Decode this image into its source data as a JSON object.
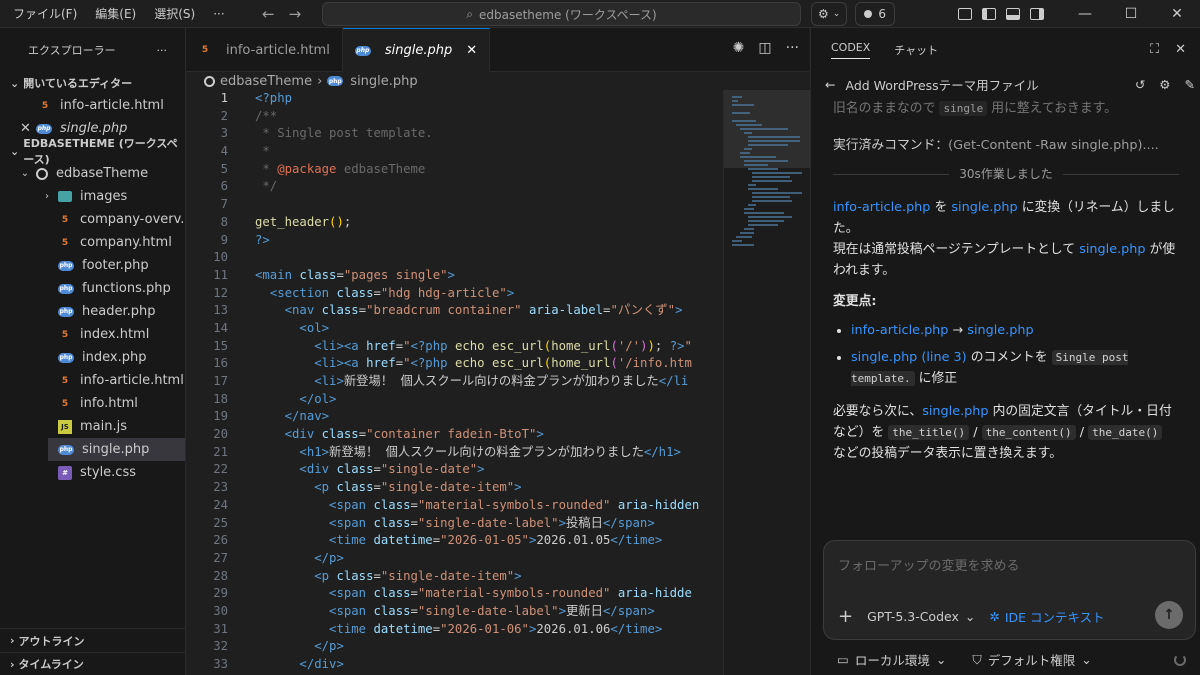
{
  "titlebar": {
    "menu": [
      "ファイル(F)",
      "編集(E)",
      "選択(S)",
      "···"
    ],
    "search": "edbasetheme (ワークスペース)",
    "badge_count": "6"
  },
  "sidebar": {
    "title": "エクスプローラー",
    "more": "···",
    "open_editors_label": "開いているエディター",
    "open_editors": [
      {
        "name": "info-article.html",
        "type": "html"
      },
      {
        "name": "single.php",
        "type": "php"
      }
    ],
    "workspace_label": "EDBASETHEME (ワークスペース)",
    "root_folder": "edbaseTheme",
    "files": [
      {
        "name": "images",
        "type": "folder"
      },
      {
        "name": "company-overv...",
        "type": "html"
      },
      {
        "name": "company.html",
        "type": "html"
      },
      {
        "name": "footer.php",
        "type": "php"
      },
      {
        "name": "functions.php",
        "type": "php"
      },
      {
        "name": "header.php",
        "type": "php"
      },
      {
        "name": "index.html",
        "type": "html"
      },
      {
        "name": "index.php",
        "type": "php"
      },
      {
        "name": "info-article.html",
        "type": "html"
      },
      {
        "name": "info.html",
        "type": "html"
      },
      {
        "name": "main.js",
        "type": "js"
      },
      {
        "name": "single.php",
        "type": "php"
      },
      {
        "name": "style.css",
        "type": "css"
      }
    ],
    "outline_label": "アウトライン",
    "timeline_label": "タイムライン"
  },
  "editor": {
    "tabs": [
      {
        "name": "info-article.html",
        "type": "html"
      },
      {
        "name": "single.php",
        "type": "php"
      }
    ],
    "breadcrumb": [
      "edbaseTheme",
      "single.php"
    ],
    "line_numbers": [
      "1",
      "2",
      "3",
      "4",
      "5",
      "6",
      "7",
      "8",
      "9",
      "10",
      "11",
      "12",
      "13",
      "14",
      "15",
      "16",
      "17",
      "18",
      "19",
      "20",
      "21",
      "22",
      "23",
      "24",
      "25",
      "26",
      "27",
      "28",
      "29",
      "30",
      "31",
      "32",
      "33"
    ]
  },
  "panel": {
    "tabs": [
      "CODEX",
      "チャット"
    ],
    "thread_title": "Add WordPressテーマ用ファイル",
    "msg_top_a": "旧名のままなので",
    "msg_top_chip": "single",
    "msg_top_b": "用に整えておきます。",
    "cmd_label": "実行済みコマンド：",
    "cmd_text": "(Get-Content -Raw single.php)....",
    "divider": "30s作業しました",
    "p1_link1": "info-article.php",
    "p1_t1": " を ",
    "p1_link2": "single.php",
    "p1_t2": " に変換（リネーム）しました。",
    "p2_t1": "現在は通常投稿ページテンプレートとして ",
    "p2_link": "single.php",
    "p2_t2": " が使われます。",
    "changes_label": "変更点:",
    "b1_link1": "info-article.php",
    "b1_arrow": " → ",
    "b1_link2": "single.php",
    "b2_link": "single.php (line 3)",
    "b2_t1": " のコメントを ",
    "b2_chip": "Single post template.",
    "b2_t2": " に修正",
    "p3_t1": "必要なら次に、",
    "p3_link": "single.php",
    "p3_t2": " 内の固定文言（タイトル・日付など）を ",
    "p3_chip1": "the_title()",
    "p3_sep1": " / ",
    "p3_chip2": "the_content()",
    "p3_sep2": " / ",
    "p3_chip3": "the_date()",
    "p3_t3": " などの投稿データ表示に置き換えます。",
    "input_placeholder": "フォローアップの変更を求める",
    "model": "GPT-5.3-Codex",
    "ide_context": "IDE コンテキスト",
    "footer_env": "ローカル環境",
    "footer_perm": "デフォルト権限"
  },
  "colors": {
    "accent": "#0078d4",
    "link": "#3794ff",
    "bg": "#1f1f1f",
    "sidebar": "#181818"
  }
}
